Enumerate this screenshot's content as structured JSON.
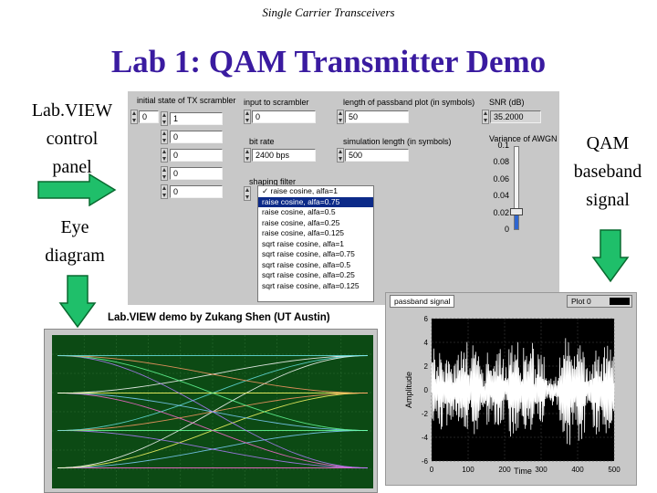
{
  "slide": {
    "header": "Single Carrier Transceivers",
    "title": "Lab 1: QAM Transmitter Demo",
    "label_control_panel": [
      "Lab.VIEW",
      "control",
      "panel"
    ],
    "label_eye_diagram": [
      "Eye",
      "diagram"
    ],
    "label_qam": [
      "QAM",
      "baseband",
      "signal"
    ],
    "credit": "Lab.VIEW demo by Zukang Shen (UT Austin)"
  },
  "panel": {
    "scrambler": {
      "label": "initial state of TX scrambler",
      "index": "0",
      "values": [
        "1",
        "0",
        "0",
        "0",
        "0"
      ]
    },
    "input_scrambler": {
      "label": "input to scrambler",
      "value": "0"
    },
    "bit_rate": {
      "label": "bit rate",
      "value": "2400 bps"
    },
    "passband_len": {
      "label": "length of passband plot (in symbols)",
      "value": "50"
    },
    "sim_len": {
      "label": "simulation length (in symbols)",
      "value": "500"
    },
    "snr": {
      "label": "SNR (dB)",
      "value": "35.2000"
    },
    "variance": {
      "label": "Variance of AWGN",
      "ticks": [
        "0.1",
        "0.08",
        "0.06",
        "0.04",
        "0.02",
        "0"
      ],
      "level": 0.022,
      "max": 0.1
    },
    "shaping_filter": {
      "label": "shaping filter",
      "selected_index": 1,
      "options": [
        "✓ raise cosine, alfa=1",
        "raise cosine, alfa=0.75",
        "raise cosine, alfa=0.5",
        "raise cosine, alfa=0.25",
        "raise cosine, alfa=0.125",
        "sqrt raise cosine, alfa=1",
        "sqrt raise cosine, alfa=0.75",
        "sqrt raise cosine, alfa=0.5",
        "sqrt raise cosine, alfa=0.25",
        "sqrt raise cosine, alfa=0.125"
      ]
    }
  },
  "passband": {
    "title": "passband signal",
    "plot_label": "Plot 0",
    "xlabel": "Time",
    "ylabel": "Amplitude",
    "xticks": [
      "0",
      "100",
      "200",
      "300",
      "400",
      "500"
    ],
    "yticks": [
      "6",
      "4",
      "2",
      "0",
      "-2",
      "-4",
      "-6"
    ]
  },
  "chart_data": [
    {
      "type": "line",
      "title": "passband signal",
      "xlabel": "Time",
      "ylabel": "Amplitude",
      "xlim": [
        0,
        500
      ],
      "ylim": [
        -6,
        6
      ],
      "grid": true,
      "series": [
        {
          "name": "Plot 0",
          "description_samples": 500,
          "color": "#ffffff"
        }
      ]
    }
  ],
  "colors": {
    "title": "#3a1ba0",
    "arrow_fill": "#1fbf6a",
    "eye_bg": "#0c4a14",
    "plot_bg": "#000000",
    "selected": "#0c2a88"
  }
}
